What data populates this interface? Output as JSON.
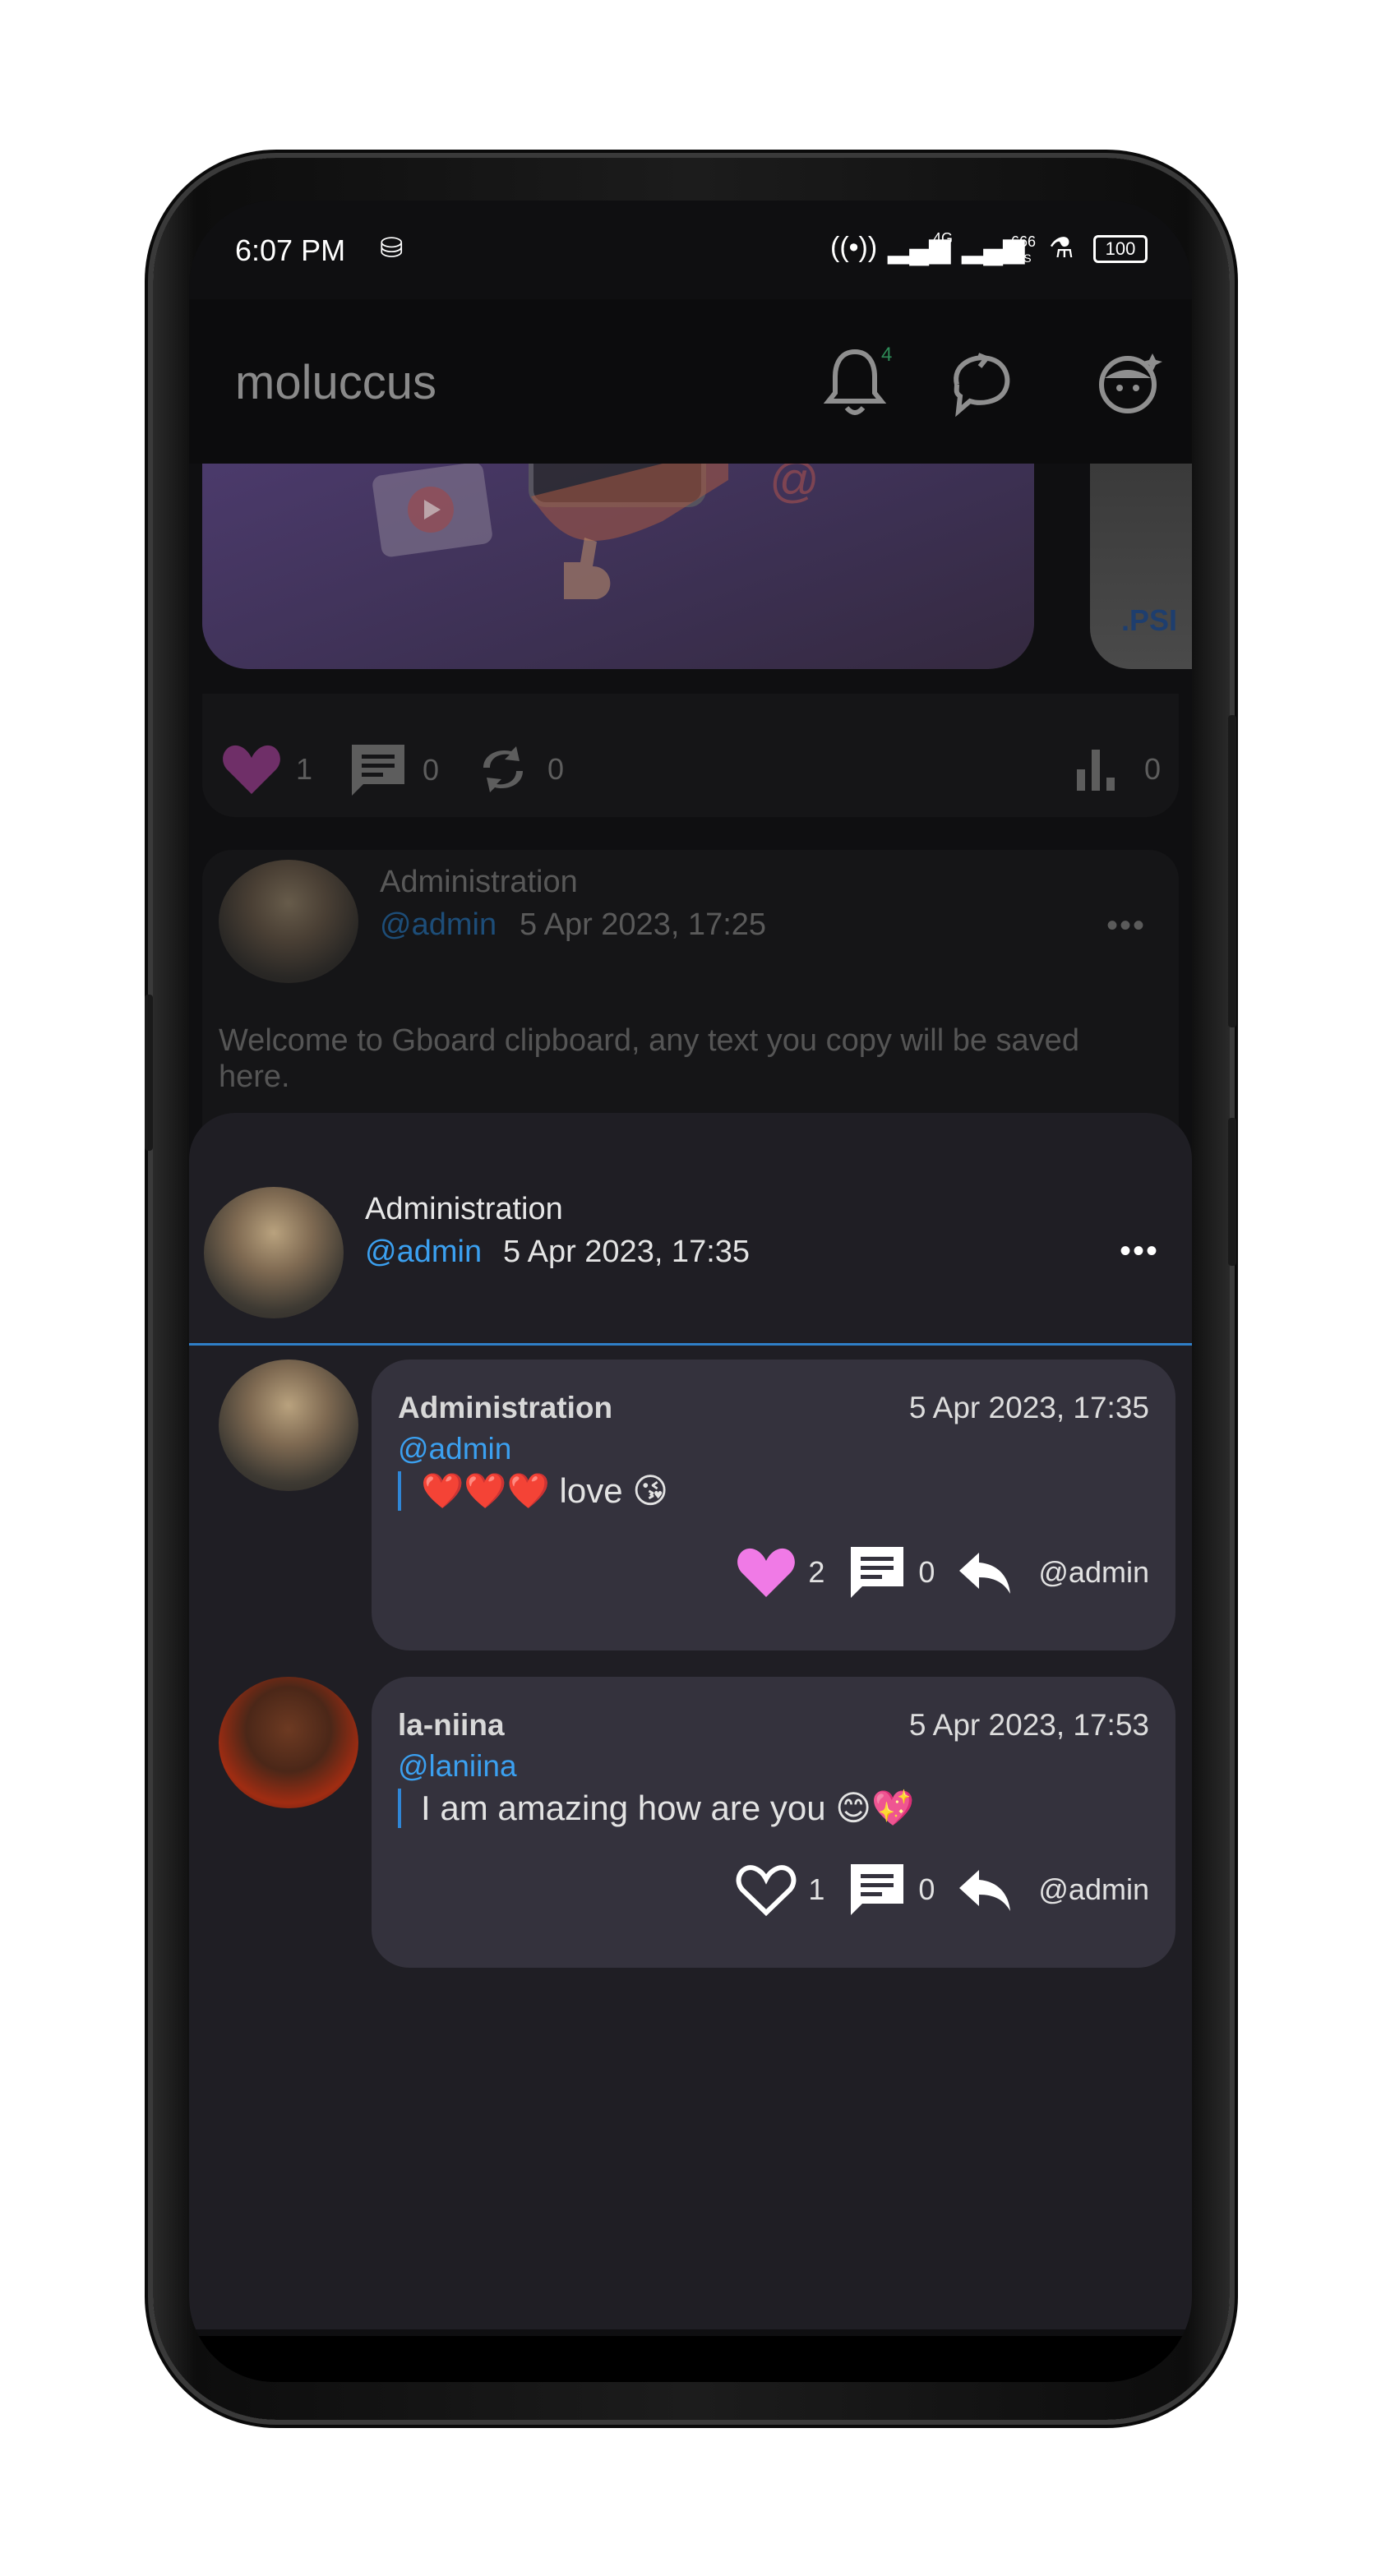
{
  "status_bar": {
    "time": "6:07 PM",
    "network": "4G",
    "speed_value": "666",
    "speed_unit": "B/S",
    "battery": "100"
  },
  "app_bar": {
    "title": "moluccus",
    "notification_count": "4"
  },
  "post_actions": {
    "likes": "1",
    "comments": "0",
    "reposts": "0",
    "views": "0"
  },
  "bg_post": {
    "author_name": "Administration",
    "author_handle": "@admin",
    "date": "5 Apr 2023, 17:25",
    "menu": "•••",
    "text": "Welcome to Gboard clipboard, any text you copy will be saved here."
  },
  "sheet": {
    "author_name": "Administration",
    "author_handle": "@admin",
    "date": "5 Apr 2023, 17:35",
    "menu": "•••"
  },
  "comments": [
    {
      "name": "Administration",
      "handle": "@admin",
      "date": "5 Apr 2023, 17:35",
      "text": "❤️❤️❤️ love 😘",
      "likes": "2",
      "replies": "0",
      "reply_to": "@admin",
      "liked": true
    },
    {
      "name": "la-niina",
      "handle": "@laniina",
      "date": "5 Apr 2023, 17:53",
      "text": "I am amazing how are you 😊💖",
      "likes": "1",
      "replies": "0",
      "reply_to": "@admin",
      "liked": false
    }
  ],
  "colors": {
    "accent": "#3ba0f0",
    "like_active": "#f07ae6",
    "sheet_bg": "#1f1e24",
    "comment_bg": "#34323d"
  }
}
